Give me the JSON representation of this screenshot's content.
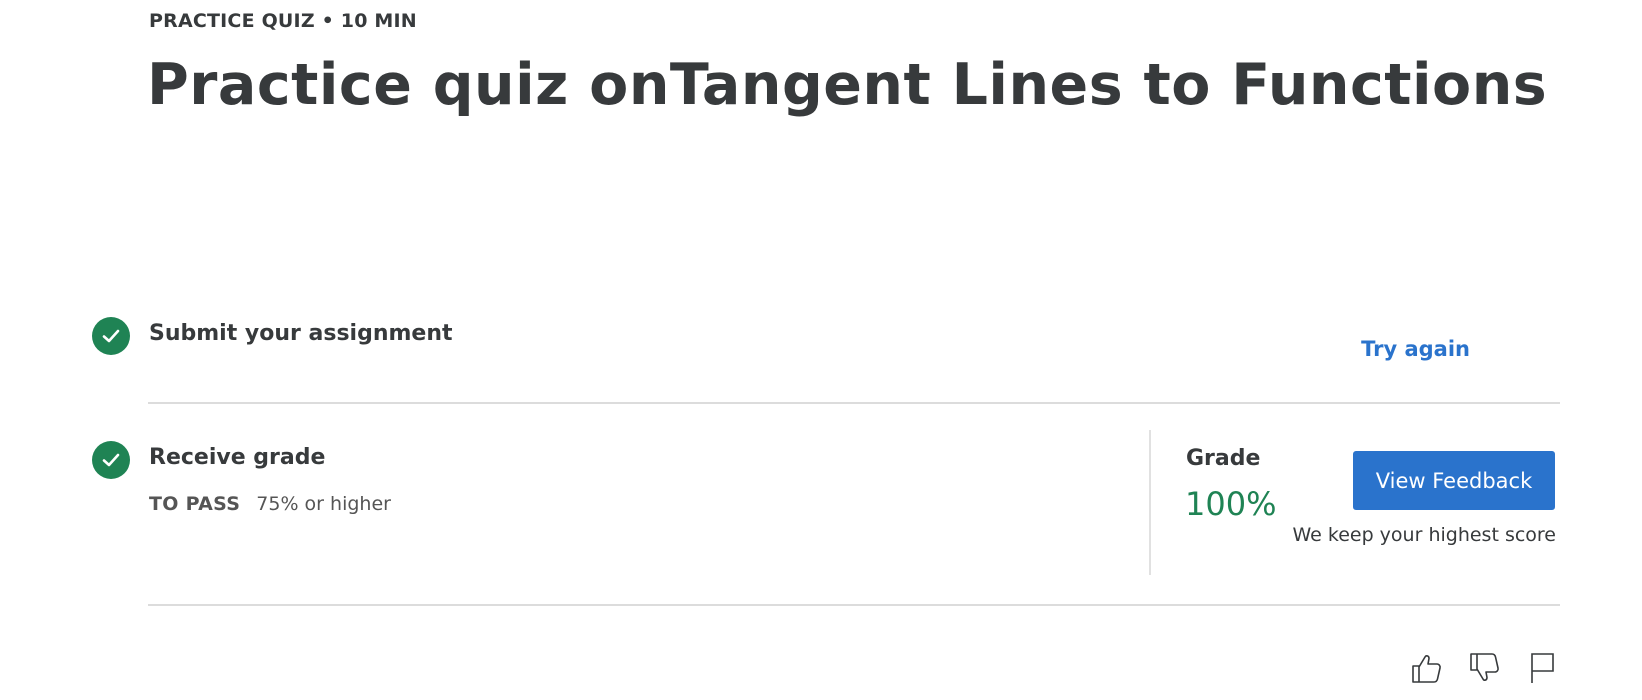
{
  "header": {
    "eyebrow": "PRACTICE QUIZ • 10 MIN",
    "title": "Practice quiz onTangent Lines to Functions"
  },
  "submit_step": {
    "title": "Submit your assignment",
    "action": "Try again",
    "status_icon": "check-circle-icon"
  },
  "grade_step": {
    "title": "Receive grade",
    "pass_label": "TO PASS",
    "pass_value": "75% or higher",
    "grade_label": "Grade",
    "grade_value": "100%",
    "button_label": "View Feedback",
    "note": "We keep your highest score",
    "status_icon": "check-circle-icon"
  },
  "feedback": {
    "icons": [
      "thumbs-up-icon",
      "thumbs-down-icon",
      "flag-icon"
    ]
  },
  "colors": {
    "success": "#1f8354",
    "primary": "#2a73cc",
    "text": "#373a3c",
    "divider": "#dcdcdc"
  }
}
